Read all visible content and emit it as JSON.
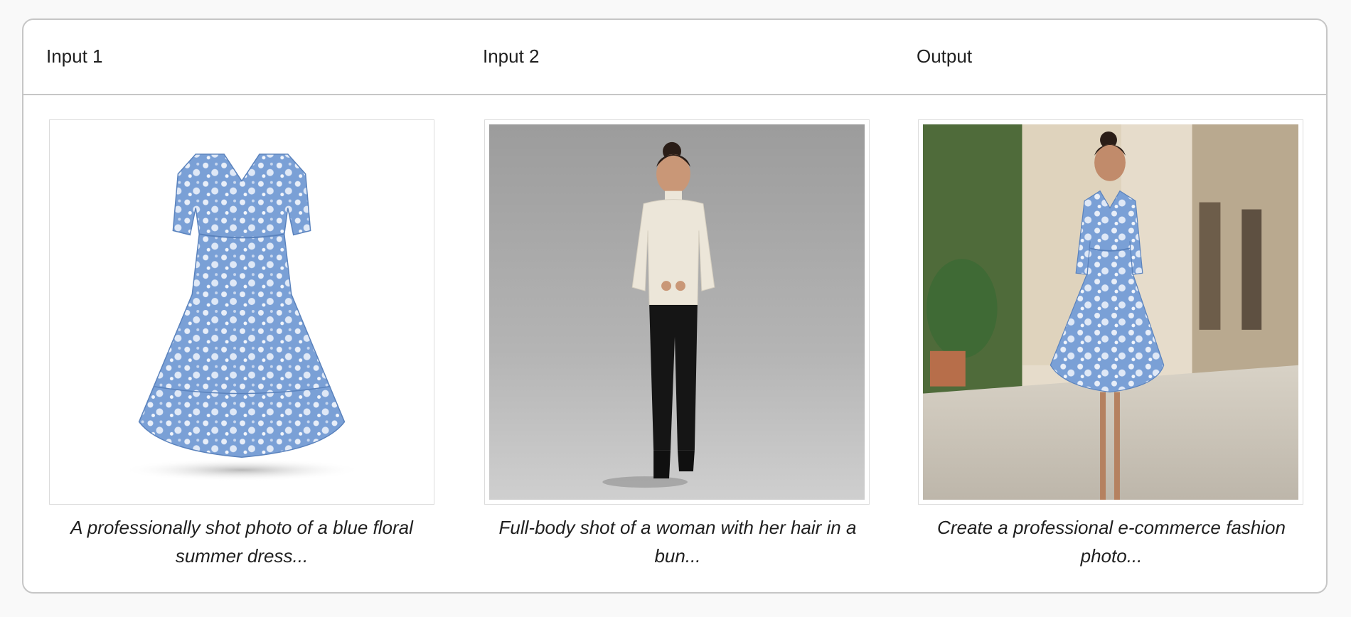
{
  "columns": [
    {
      "title": "Input 1",
      "caption": "A professionally shot photo of a blue floral summer dress...",
      "image": "product-photo-blue-floral-dress"
    },
    {
      "title": "Input 2",
      "caption": "Full-body shot of a woman with her hair in a bun...",
      "image": "model-photo-white-turtleneck-black-pants"
    },
    {
      "title": "Output",
      "caption": "Create a professional e-commerce fashion photo...",
      "image": "generated-photo-model-in-floral-dress-street"
    }
  ],
  "colors": {
    "card_border": "#c6c6c6",
    "dress_blue": "#7aa0d6",
    "page_bg": "#f9f9f9"
  }
}
